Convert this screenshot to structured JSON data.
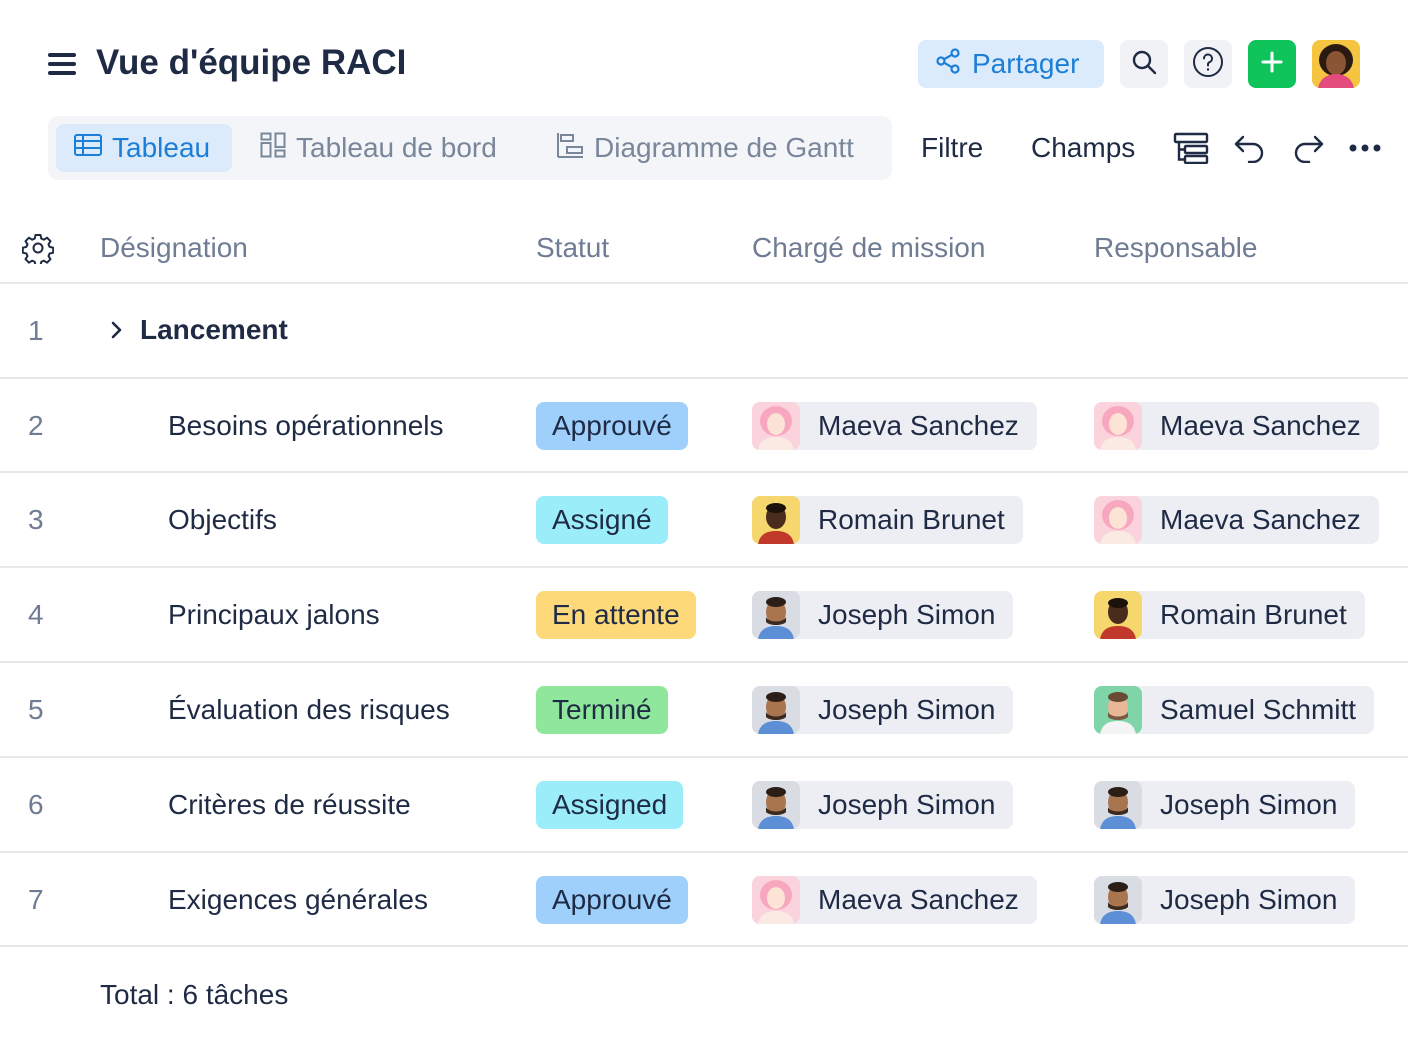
{
  "header": {
    "title": "Vue d'équipe RACI",
    "share_label": "Partager",
    "icons": [
      "menu-icon",
      "share-icon",
      "search-icon",
      "help-icon",
      "plus-icon",
      "user-avatar"
    ]
  },
  "view_tabs": [
    {
      "label": "Tableau",
      "icon": "table-icon",
      "active": true
    },
    {
      "label": "Tableau de bord",
      "icon": "dashboard-icon",
      "active": false
    },
    {
      "label": "Diagramme de Gantt",
      "icon": "gantt-icon",
      "active": false
    }
  ],
  "toolbar": {
    "filter_label": "Filtre",
    "fields_label": "Champs",
    "icons": [
      "hierarchy-icon",
      "undo-icon",
      "redo-icon",
      "more-icon"
    ]
  },
  "table": {
    "columns": [
      "Désignation",
      "Statut",
      "Chargé de mission",
      "Responsable"
    ],
    "group": {
      "number": "1",
      "name": "Lancement"
    },
    "rows": [
      {
        "number": "2",
        "name": "Besoins opérationnels",
        "status": "Approuvé",
        "charge": "Maeva Sanchez",
        "responsable": "Maeva Sanchez"
      },
      {
        "number": "3",
        "name": "Objectifs",
        "status": "Assigné",
        "charge": "Romain Brunet",
        "responsable": "Maeva Sanchez"
      },
      {
        "number": "4",
        "name": "Principaux jalons",
        "status": "En attente",
        "charge": "Joseph Simon",
        "responsable": "Romain Brunet"
      },
      {
        "number": "5",
        "name": "Évaluation des risques",
        "status": "Terminé",
        "charge": "Joseph Simon",
        "responsable": "Samuel Schmitt"
      },
      {
        "number": "6",
        "name": "Critères de réussite",
        "status": "Assigned",
        "charge": "Joseph Simon",
        "responsable": "Joseph Simon"
      },
      {
        "number": "7",
        "name": "Exigences générales",
        "status": "Approuvé",
        "charge": "Maeva Sanchez",
        "responsable": "Joseph Simon"
      }
    ],
    "total": "Total : 6 tâches"
  },
  "colors": {
    "accent": "#1c7ed6",
    "add_button": "#10c45c",
    "status_approved": "#9fd0fb",
    "status_assigned": "#9aedf9",
    "status_pending": "#fdd97a",
    "status_done": "#8fe79b"
  }
}
